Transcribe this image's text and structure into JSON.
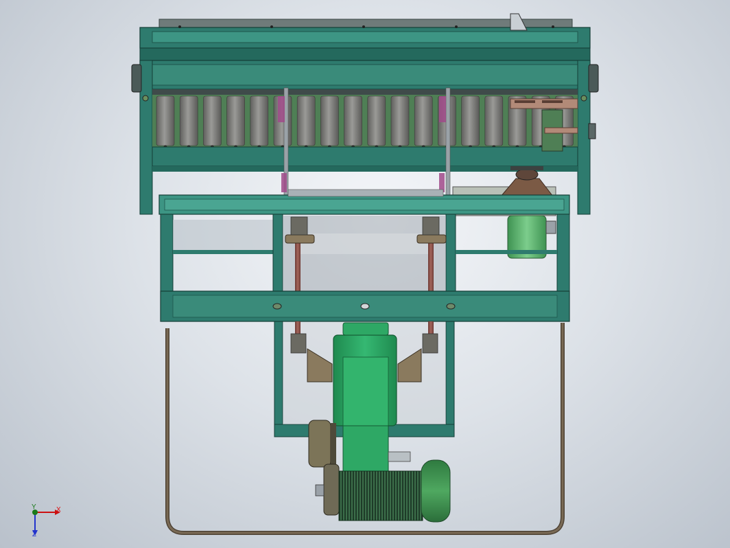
{
  "viewport": {
    "background_top": "#f4f6f9",
    "background_bottom": "#b9c1cb"
  },
  "colors": {
    "frame": "#2e7b6e",
    "frame_dark": "#1d564c",
    "frame_light": "#3d9584",
    "roller": "#7a7a78",
    "roller_gap": "#4f7f55",
    "gearbox": "#2ea865",
    "motor": "#3a8f4e",
    "motor_small": "#58ad6b",
    "pipe": "#6b5a44",
    "bracket": "#8a7a5e",
    "shaft": "#8b5048",
    "accent_pink": "#a04a8a",
    "mount_plate": "#b28a78"
  },
  "triad": {
    "x_label": "X",
    "y_label": "Y",
    "z_label": "Z",
    "x_color": "#cc1111",
    "y_color": "#1a7a1a",
    "z_color": "#2233cc"
  },
  "icons": {
    "triad": "coordinate-triad-icon"
  }
}
